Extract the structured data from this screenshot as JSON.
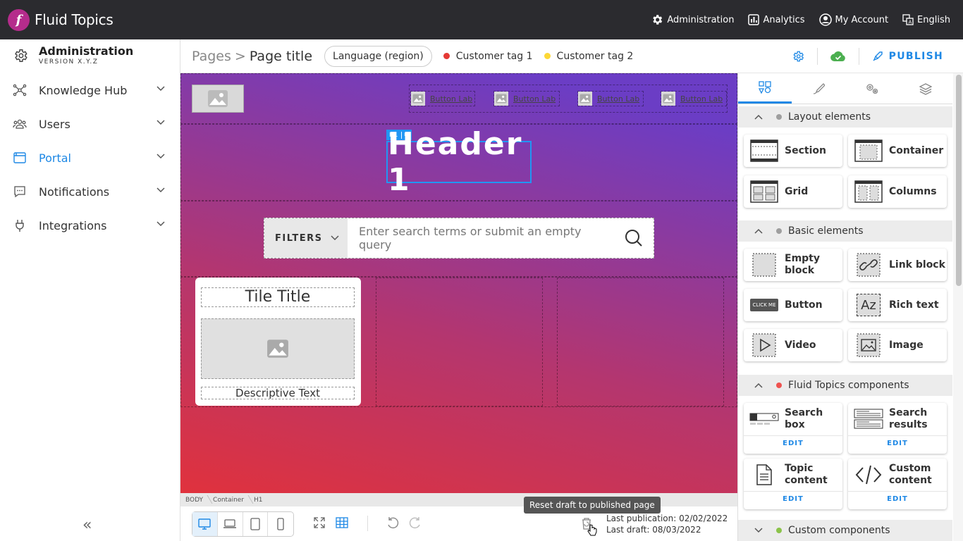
{
  "app": {
    "logo_letter": "f",
    "name": "Fluid Topics"
  },
  "topnav": {
    "administration": "Administration",
    "analytics": "Analytics",
    "my_account": "My Account",
    "language": "English"
  },
  "sidebar": {
    "title": "Administration",
    "version": "VERSION X.Y.Z",
    "items": [
      {
        "label": "Knowledge Hub",
        "icon": "hub-icon"
      },
      {
        "label": "Users",
        "icon": "users-icon"
      },
      {
        "label": "Portal",
        "icon": "portal-icon",
        "active": true
      },
      {
        "label": "Notifications",
        "icon": "chat-icon"
      },
      {
        "label": "Integrations",
        "icon": "plug-icon"
      }
    ],
    "collapse_glyph": "«"
  },
  "pagebar": {
    "crumb_pages": "Pages",
    "crumb_sep": ">",
    "page_title": "Page title",
    "language_pill": "Language (region)",
    "tags": [
      {
        "label": "Customer tag 1",
        "color": "#e53935"
      },
      {
        "label": "Customer tag 2",
        "color": "#fdd835"
      }
    ],
    "publish_label": "PUBLISH"
  },
  "canvas": {
    "button_labels": [
      "Button Label",
      "Button Label",
      "Button Label",
      "Button Label"
    ],
    "h1_tag": "H1",
    "header_text": "Header 1",
    "search_filters": "FILTERS",
    "search_placeholder": "Enter search terms or submit an empty query",
    "tile_title": "Tile Title",
    "tile_desc": "Descriptive Text"
  },
  "element_path": [
    "BODY",
    "Container",
    "H1"
  ],
  "bottombar": {
    "tooltip": "Reset draft to published page",
    "last_publication": "Last publication: 02/02/2022",
    "last_draft": "Last draft: 08/03/2022"
  },
  "panel": {
    "sections": {
      "layout": {
        "title": "Layout elements",
        "dot": "#9e9e9e"
      },
      "basic": {
        "title": "Basic elements",
        "dot": "#9e9e9e"
      },
      "ft": {
        "title": "Fluid Topics components",
        "dot": "#ef5350"
      },
      "custom": {
        "title": "Custom components",
        "dot": "#8bc34a"
      }
    },
    "layout_items": [
      "Section",
      "Container",
      "Grid",
      "Columns"
    ],
    "basic_items": [
      "Empty block",
      "Link block",
      "Button",
      "Rich text",
      "Video",
      "Image"
    ],
    "button_icon_text": "CLICK ME",
    "richtext_icon_text": "Az",
    "ft_items": [
      "Search box",
      "Search results",
      "Topic content",
      "Custom content"
    ],
    "edit_label": "EDIT"
  },
  "colors": {
    "accent": "#1e88e5",
    "topbar": "#2b2b2f",
    "logo": "#b52c8c"
  }
}
